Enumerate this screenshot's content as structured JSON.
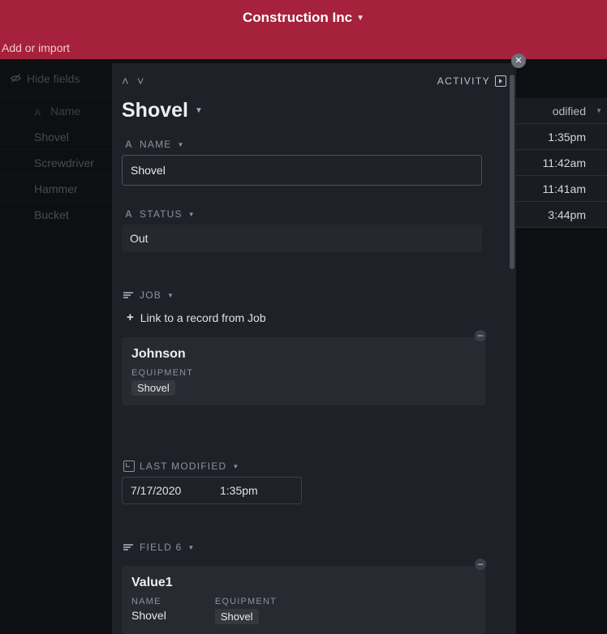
{
  "header": {
    "company": "Construction Inc",
    "add_import": "Add or import"
  },
  "toolbar": {
    "hide_fields": "Hide fields"
  },
  "grid": {
    "columns": {
      "name": "Name",
      "modified_short": "odified"
    },
    "rows": [
      {
        "name": "Shovel",
        "time": "1:35pm"
      },
      {
        "name": "Screwdriver",
        "time": "11:42am"
      },
      {
        "name": "Hammer",
        "time": "11:41am"
      },
      {
        "name": "Bucket",
        "time": "3:44pm"
      }
    ]
  },
  "panel": {
    "activity_label": "ACTIVITY",
    "title": "Shovel",
    "fields": {
      "name": {
        "label": "NAME",
        "value": "Shovel"
      },
      "status": {
        "label": "STATUS",
        "value": "Out"
      },
      "job": {
        "label": "JOB",
        "link_prompt": "Link to a record from Job",
        "linked": {
          "title": "Johnson",
          "sub_label": "EQUIPMENT",
          "sub_value": "Shovel"
        }
      },
      "last_modified": {
        "label": "LAST MODIFIED",
        "date": "7/17/2020",
        "time": "1:35pm"
      },
      "field6": {
        "label": "FIELD 6",
        "linked": {
          "title": "Value1",
          "cols": [
            {
              "label": "NAME",
              "value": "Shovel"
            },
            {
              "label": "EQUIPMENT",
              "value": "Shovel"
            }
          ]
        }
      }
    }
  }
}
